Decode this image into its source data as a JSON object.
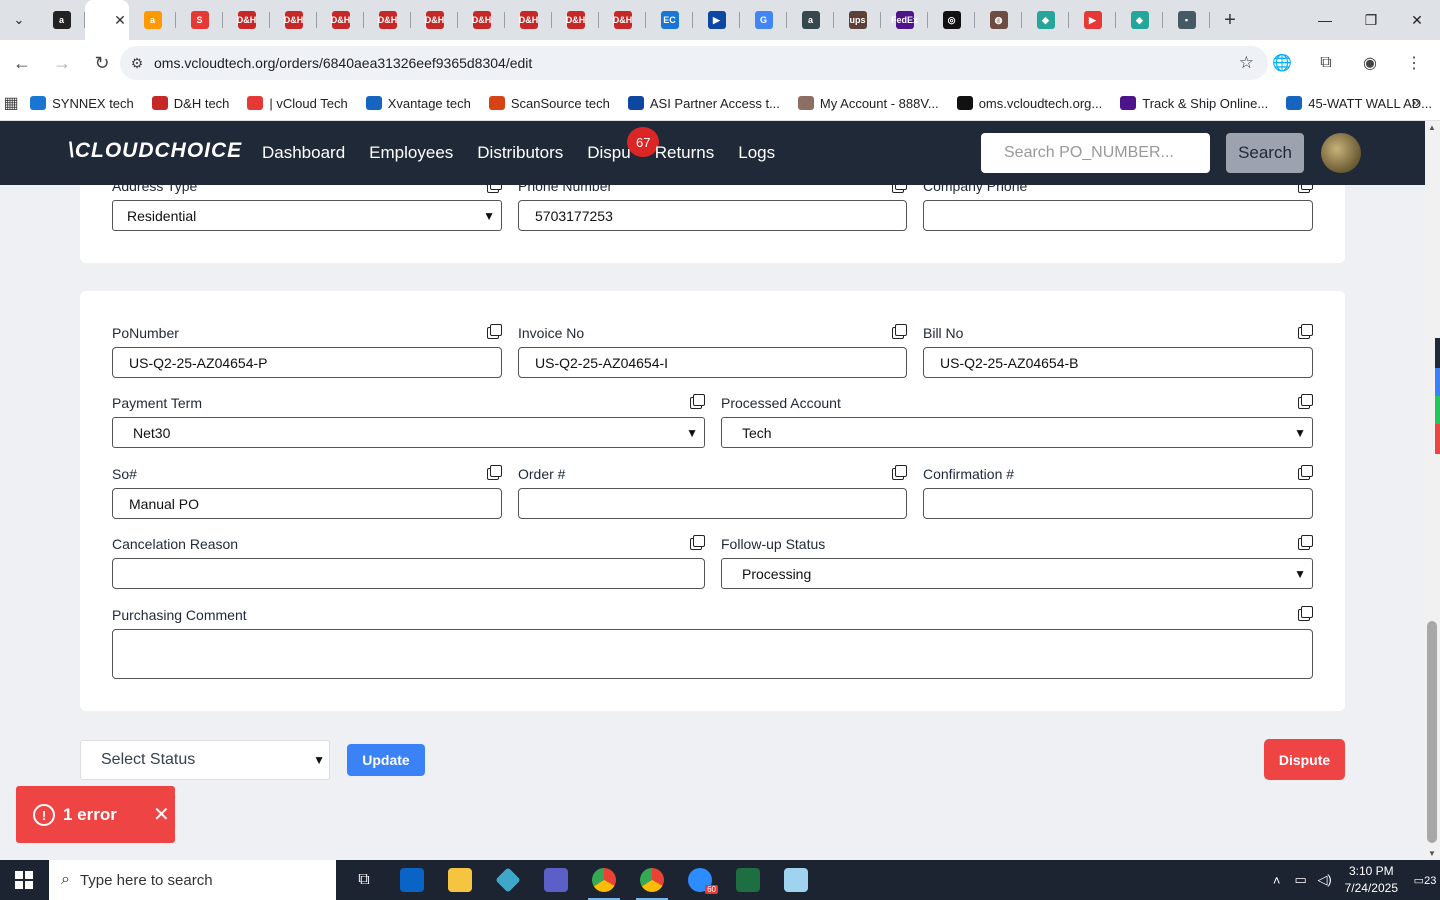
{
  "browser": {
    "tabs": [
      {
        "label": "a",
        "color": "#222222"
      },
      {
        "label": "",
        "color": "#ffffff",
        "active": true
      },
      {
        "label": "a",
        "color": "#ff9900"
      },
      {
        "label": "S",
        "color": "#e53935"
      },
      {
        "label": "D&H",
        "color": "#c62828"
      },
      {
        "label": "D&H",
        "color": "#c62828"
      },
      {
        "label": "D&H",
        "color": "#c62828"
      },
      {
        "label": "D&H",
        "color": "#c62828"
      },
      {
        "label": "D&H",
        "color": "#c62828"
      },
      {
        "label": "D&H",
        "color": "#c62828"
      },
      {
        "label": "D&H",
        "color": "#c62828"
      },
      {
        "label": "D&H",
        "color": "#c62828"
      },
      {
        "label": "D&H",
        "color": "#c62828"
      },
      {
        "label": "EC",
        "color": "#1976d2"
      },
      {
        "label": "▶",
        "color": "#0d47a1"
      },
      {
        "label": "G",
        "color": "#4285f4"
      },
      {
        "label": "a",
        "color": "#37474f"
      },
      {
        "label": "ups",
        "color": "#5d4037"
      },
      {
        "label": "FedEx",
        "color": "#4d148c"
      },
      {
        "label": "◎",
        "color": "#111111"
      },
      {
        "label": "◍",
        "color": "#6d4c41"
      },
      {
        "label": "◆",
        "color": "#26a69a"
      },
      {
        "label": "▶",
        "color": "#e53935"
      },
      {
        "label": "◆",
        "color": "#26a69a"
      },
      {
        "label": "▪",
        "color": "#455a64"
      }
    ],
    "url": "oms.vcloudtech.org/orders/6840aea31326eef9365d8304/edit",
    "bookmarks": [
      {
        "label": "SYNNEX tech",
        "color": "#1976d2"
      },
      {
        "label": "D&H tech",
        "color": "#c62828"
      },
      {
        "label": "| vCloud Tech",
        "color": "#e53935"
      },
      {
        "label": "Xvantage tech",
        "color": "#1565c0"
      },
      {
        "label": "ScanSource tech",
        "color": "#d84315"
      },
      {
        "label": "ASI Partner Access t...",
        "color": "#0d47a1"
      },
      {
        "label": "My Account - 888V...",
        "color": "#8d6e63"
      },
      {
        "label": "oms.vcloudtech.org...",
        "color": "#111111"
      },
      {
        "label": "Track & Ship Online...",
        "color": "#4d148c"
      },
      {
        "label": "45-WATT WALL AD...",
        "color": "#1565c0"
      }
    ]
  },
  "app": {
    "logo": "\\CLOUDCHOICE",
    "nav": [
      "Dashboard",
      "Employees",
      "Distributors",
      "Dispu",
      "Returns",
      "Logs"
    ],
    "disputes_badge": "67",
    "search_placeholder": "Search PO_NUMBER...",
    "search_button": "Search"
  },
  "address_card": {
    "address_type_label": "Address Type",
    "address_type_value": "Residential",
    "phone_label": "Phone Number",
    "phone_value": "5703177253",
    "company_phone_label": "Company Phone",
    "company_phone_value": ""
  },
  "order_card": {
    "po_label": "PoNumber",
    "po_value": "US-Q2-25-AZ04654-P",
    "invoice_label": "Invoice No",
    "invoice_value": "US-Q2-25-AZ04654-I",
    "bill_label": "Bill No",
    "bill_value": "US-Q2-25-AZ04654-B",
    "payment_term_label": "Payment Term",
    "payment_term_value": "Net30",
    "processed_account_label": "Processed Account",
    "processed_account_value": "Tech",
    "so_label": "So#",
    "so_value": "Manual PO",
    "order_label": "Order #",
    "order_value": "",
    "confirmation_label": "Confirmation #",
    "confirmation_value": "",
    "cancel_reason_label": "Cancelation Reason",
    "cancel_reason_value": "",
    "followup_label": "Follow-up Status",
    "followup_value": "Processing",
    "comment_label": "Purchasing Comment",
    "comment_value": ""
  },
  "actions": {
    "status_select": "Select Status",
    "update": "Update",
    "dispute": "Dispute"
  },
  "toast": {
    "text": "1 error"
  },
  "taskbar": {
    "search_placeholder": "Type here to search",
    "time": "3:10 PM",
    "date": "7/24/2025",
    "notifications": "23",
    "zoom_badge": "60"
  }
}
